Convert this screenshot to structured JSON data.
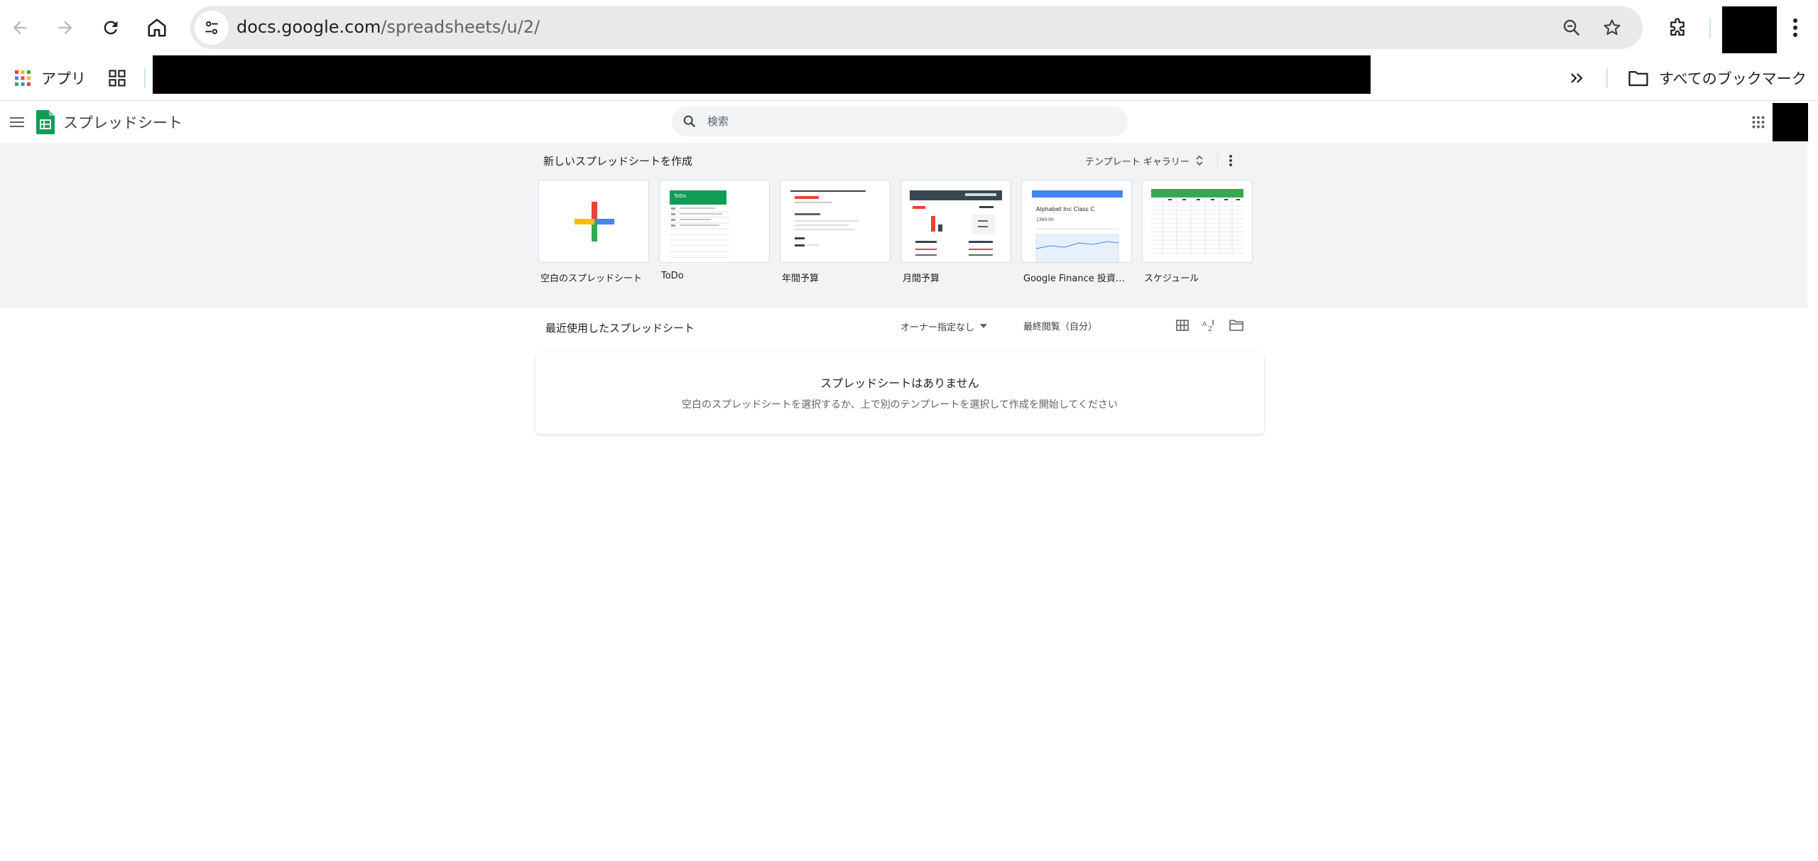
{
  "browser": {
    "url_host": "docs.google.com",
    "url_path": "/spreadsheets/u/2/"
  },
  "bookmarks": {
    "apps_label": "アプリ",
    "all_bookmarks_label": "すべてのブックマーク"
  },
  "header": {
    "app_title": "スプレッドシート",
    "search_placeholder": "検索"
  },
  "templates": {
    "section_title": "新しいスプレッドシートを作成",
    "gallery_label": "テンプレート ギャラリー",
    "items": [
      {
        "label": "空白のスプレッドシート"
      },
      {
        "label": "ToDo"
      },
      {
        "label": "年間予算"
      },
      {
        "label": "月間予算"
      },
      {
        "label": "Google Finance 投資トラッカー"
      },
      {
        "label": "スケジュール"
      }
    ],
    "todo_thumb_title": "ToDo",
    "finance_thumb_title": "Alphabet Inc Class C",
    "finance_thumb_price": "1360.00"
  },
  "recent": {
    "section_title": "最近使用したスプレッドシート",
    "owner_filter": "オーナー指定なし",
    "sort_label": "最終閲覧（自分）",
    "empty_title": "スプレッドシートはありません",
    "empty_subtitle": "空白のスプレッドシートを選択するか、上で別のテンプレートを選択して作成を開始してください"
  },
  "colors": {
    "sheets_green": "#0f9d58",
    "band_background": "#f1f3f4",
    "plus_red": "#ea4335",
    "plus_blue": "#4285f4",
    "plus_yellow": "#fbbc04",
    "plus_green": "#34a853"
  }
}
